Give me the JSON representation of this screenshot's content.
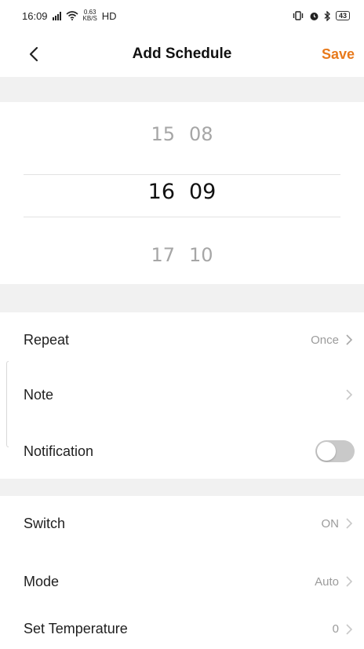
{
  "status_bar": {
    "time": "16:09",
    "net_speed_value": "0.63",
    "net_speed_unit": "KB/S",
    "hd": "HD",
    "battery": "43"
  },
  "nav": {
    "title": "Add Schedule",
    "save_label": "Save",
    "accent_color": "#e87a1c"
  },
  "time_picker": {
    "prev": {
      "hour": "15",
      "minute": "08"
    },
    "selected": {
      "hour": "16",
      "minute": "09"
    },
    "next": {
      "hour": "17",
      "minute": "10"
    }
  },
  "settings": {
    "repeat": {
      "label": "Repeat",
      "value": "Once"
    },
    "note": {
      "label": "Note",
      "value": ""
    },
    "notification": {
      "label": "Notification",
      "enabled": false
    }
  },
  "actions": {
    "switch": {
      "label": "Switch",
      "value": "ON"
    },
    "mode": {
      "label": "Mode",
      "value": "Auto"
    },
    "set_temperature": {
      "label": "Set Temperature",
      "value": "0"
    }
  }
}
